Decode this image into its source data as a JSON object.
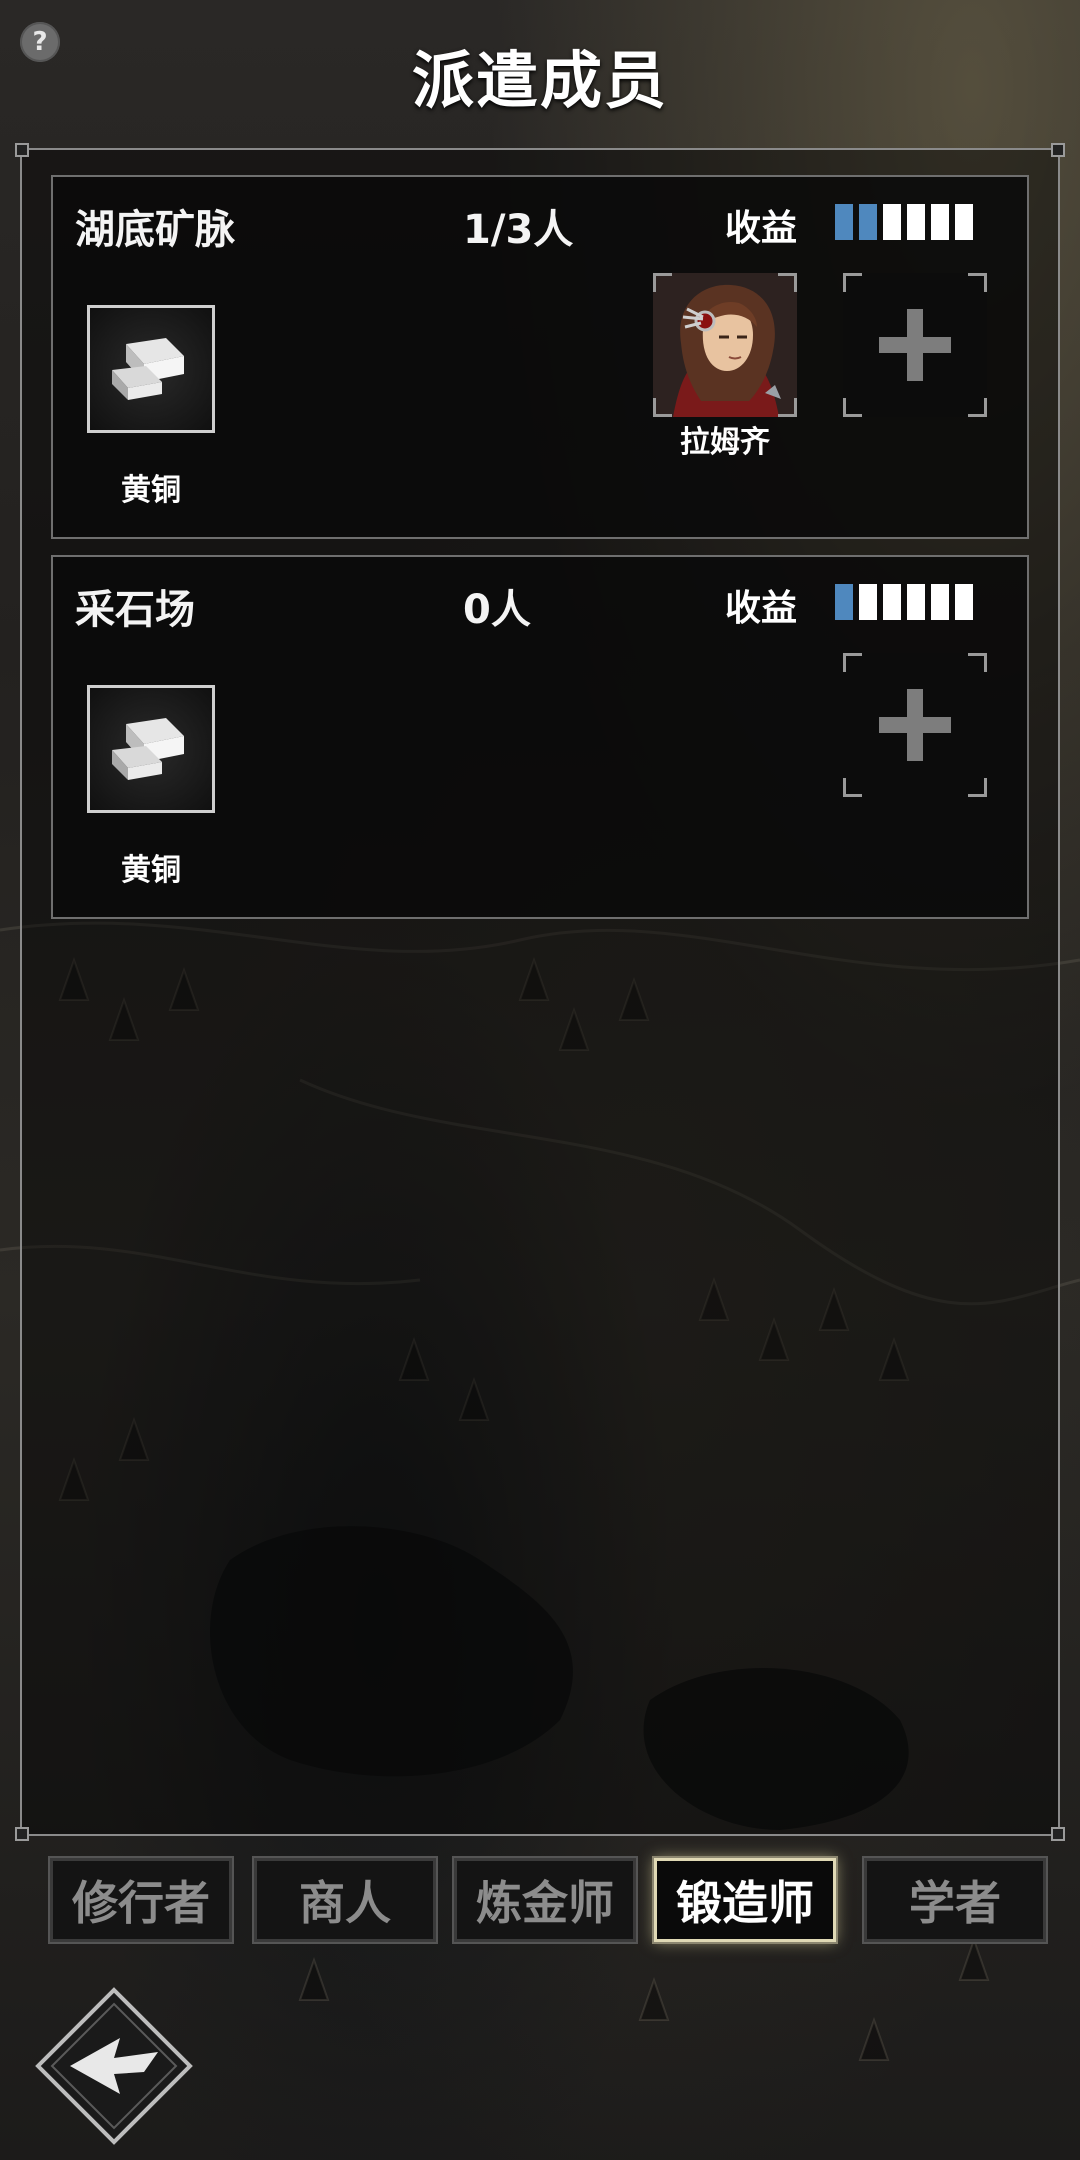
{
  "header": {
    "help_icon": "?",
    "title": "派遣成员"
  },
  "colors": {
    "yield_filled": "#4f88be",
    "yield_empty": "#ffffff",
    "active_tab_glow": "#e0d9b5"
  },
  "sites": [
    {
      "name": "湖底矿脉",
      "count": "1/3人",
      "yield_label": "收益",
      "yield_level": 2,
      "yield_max": 6,
      "resource": {
        "icon": "brass-ingot-icon",
        "label": "黄铜"
      },
      "members": [
        {
          "name": "拉姆齐",
          "portrait": "character-portrait"
        }
      ],
      "add_slot": true
    },
    {
      "name": "采石场",
      "count": "0人",
      "yield_label": "收益",
      "yield_level": 1,
      "yield_max": 6,
      "resource": {
        "icon": "brass-ingot-icon",
        "label": "黄铜"
      },
      "members": [],
      "add_slot": true
    }
  ],
  "tabs": [
    {
      "label": "修行者",
      "active": false
    },
    {
      "label": "商人",
      "active": false
    },
    {
      "label": "炼金师",
      "active": false
    },
    {
      "label": "锻造师",
      "active": true
    },
    {
      "label": "学者",
      "active": false
    }
  ],
  "footer": {
    "back_icon": "back-arrow-icon"
  }
}
